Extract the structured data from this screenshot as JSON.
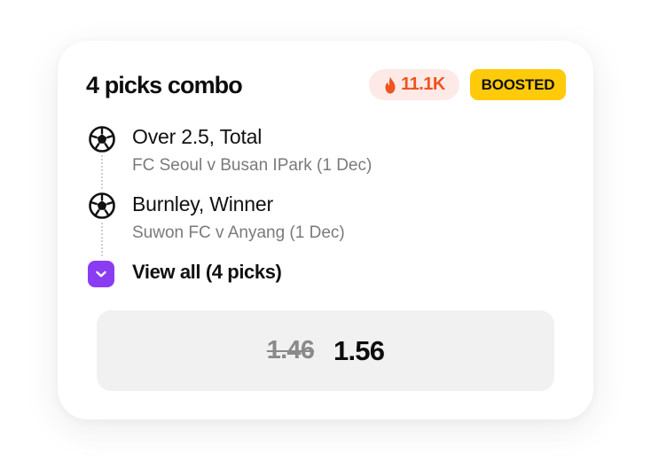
{
  "card": {
    "title": "4 picks combo",
    "hot_badge": {
      "icon": "flame-icon",
      "count": "11.1K",
      "color": "#f0531f",
      "background": "#fdeae6"
    },
    "boosted_badge": {
      "label": "BOOSTED",
      "background": "#ffca0a"
    }
  },
  "picks": [
    {
      "icon": "soccer-ball-icon",
      "selection": "Over 2.5, Total",
      "match": "FC Seoul v Busan IPark (1 Dec)"
    },
    {
      "icon": "soccer-ball-icon",
      "selection": "Burnley, Winner",
      "match": "Suwon FC v Anyang (1 Dec)"
    }
  ],
  "view_all": {
    "icon": "chevron-down-icon",
    "label": "View all (4 picks)",
    "accent": "#8a3cf2"
  },
  "odds": {
    "original": "1.46",
    "boosted": "1.56"
  }
}
